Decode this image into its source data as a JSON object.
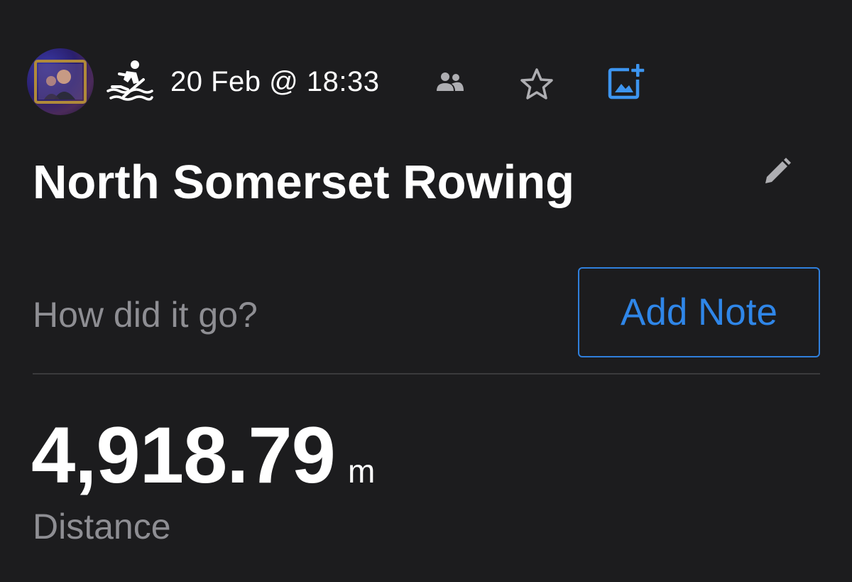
{
  "header": {
    "avatar_icon": "user-avatar",
    "sport_icon": "rowing-icon",
    "date_time": "20 Feb @ 18:33",
    "group_icon": "group-icon",
    "star_icon": "star-icon",
    "add_photo_icon": "add-photo-icon"
  },
  "activity": {
    "title": "North Somerset Rowing",
    "edit_icon": "pencil-icon"
  },
  "note": {
    "prompt": "How did it go?",
    "button_label": "Add Note"
  },
  "stat": {
    "value": "4,918.79",
    "unit": "m",
    "label": "Distance"
  },
  "colors": {
    "background": "#1c1c1e",
    "text_primary": "#ffffff",
    "text_secondary": "#8e8e93",
    "accent": "#2f86e8"
  }
}
